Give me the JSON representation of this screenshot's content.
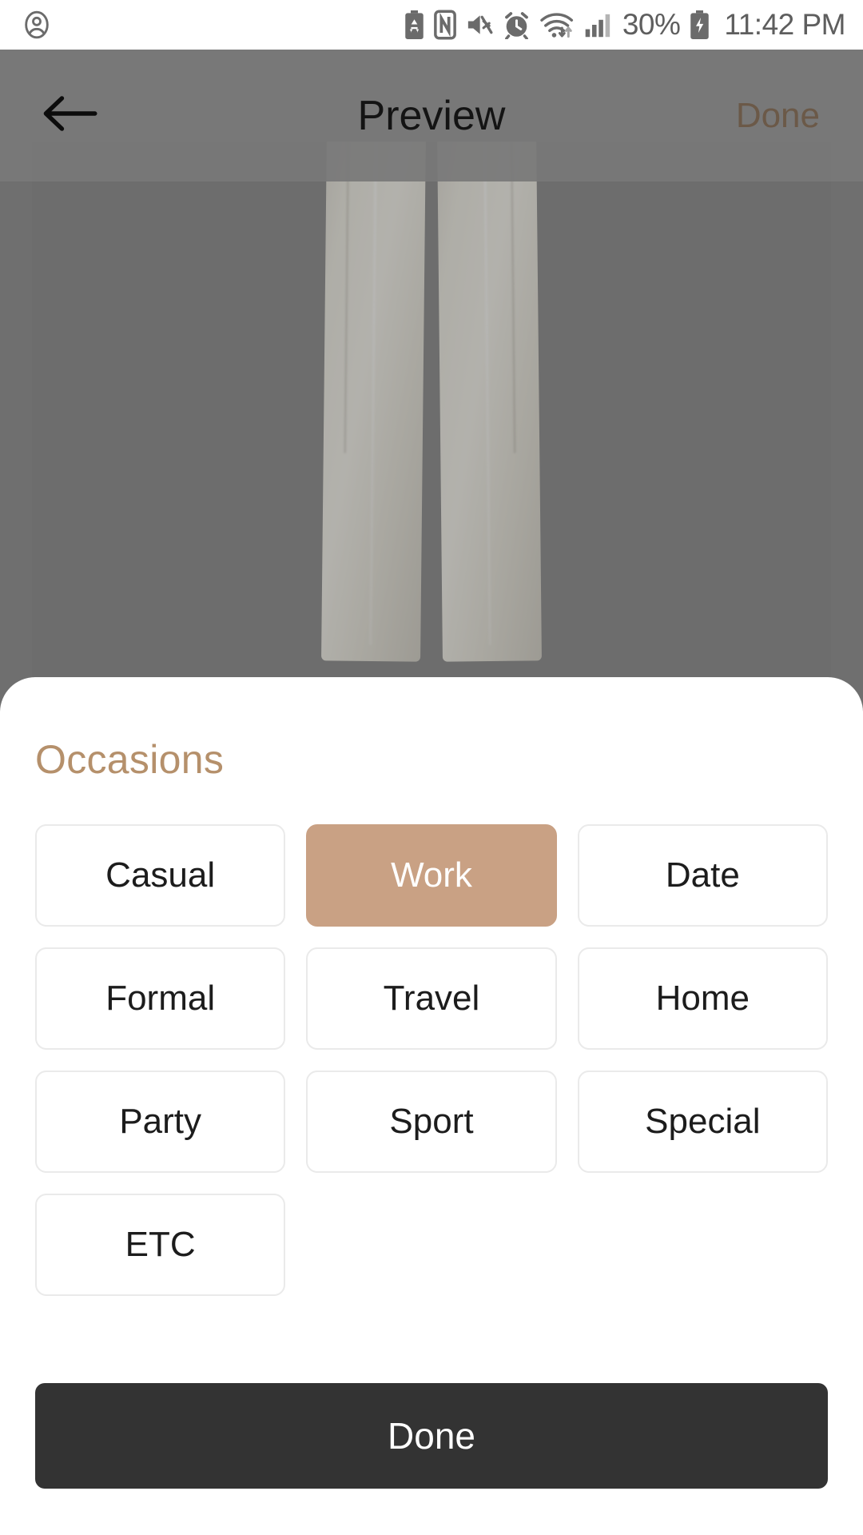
{
  "status_bar": {
    "profile_icon": "account-circle-icon",
    "icons": [
      "battery-saver-icon",
      "nfc-icon",
      "mute-icon",
      "alarm-icon",
      "wifi-data-icon",
      "cellular-signal-icon"
    ],
    "battery_percent": "30%",
    "battery_state_icon": "battery-charging-icon",
    "time": "11:42 PM"
  },
  "app_bar": {
    "back_icon": "arrow-left-icon",
    "title": "Preview",
    "done_label": "Done"
  },
  "preview": {
    "image_description": "cream wide-leg trousers"
  },
  "sheet": {
    "title": "Occasions",
    "options": [
      {
        "label": "Casual",
        "selected": false
      },
      {
        "label": "Work",
        "selected": true
      },
      {
        "label": "Date",
        "selected": false
      },
      {
        "label": "Formal",
        "selected": false
      },
      {
        "label": "Travel",
        "selected": false
      },
      {
        "label": "Home",
        "selected": false
      },
      {
        "label": "Party",
        "selected": false
      },
      {
        "label": "Sport",
        "selected": false
      },
      {
        "label": "Special",
        "selected": false
      },
      {
        "label": "ETC",
        "selected": false
      }
    ],
    "primary_button_label": "Done"
  },
  "colors": {
    "accent": "#b5906b",
    "chip_selected_bg": "#c9a184",
    "primary_button_bg": "#333333",
    "appbar_done": "#6b5948"
  }
}
